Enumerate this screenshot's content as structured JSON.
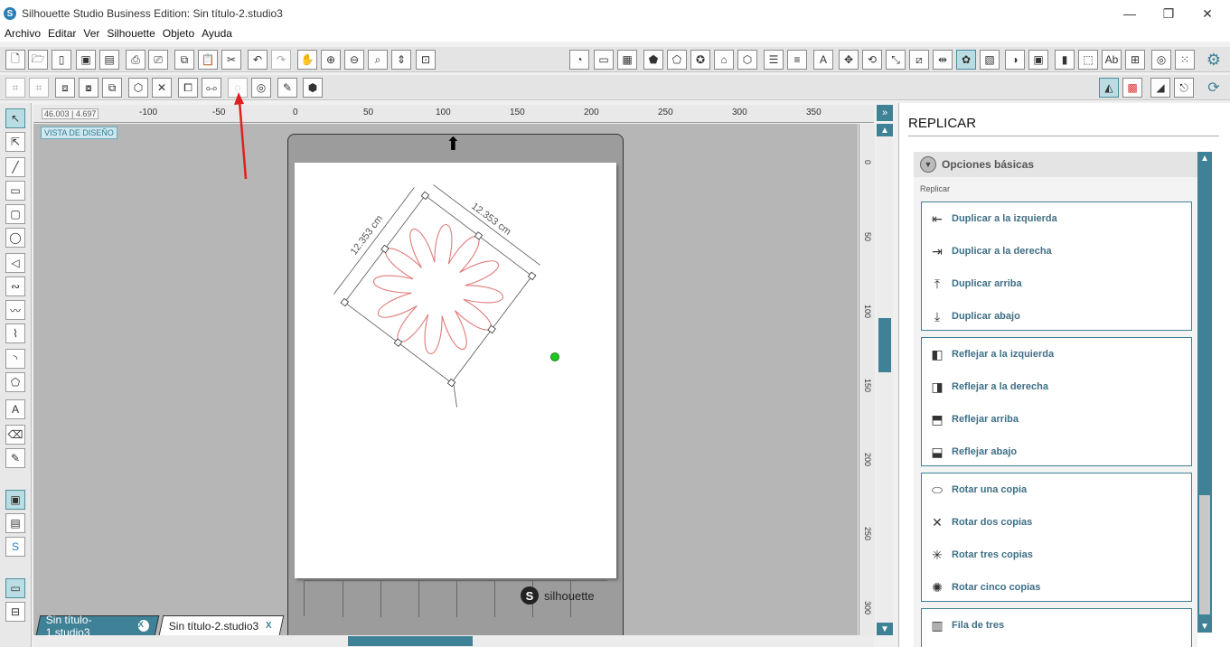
{
  "window": {
    "title": "Silhouette Studio Business Edition: Sin título-2.studio3",
    "minimize": "—",
    "restore": "❐",
    "close": "✕"
  },
  "menu": [
    "Archivo",
    "Editar",
    "Ver",
    "Silhouette",
    "Objeto",
    "Ayuda"
  ],
  "canvas": {
    "coords_x": "46.003",
    "coords_y": "4.697",
    "design_view_label": "VISTA DE DISEÑO",
    "dimension_top": "12.353 cm",
    "dimension_left": "12.353 cm",
    "mat_brand": "silhouette",
    "mat_logo_letter": "S",
    "ruler_h_labels": [
      "-100",
      "-50",
      "0",
      "50",
      "100",
      "150",
      "200",
      "250",
      "300",
      "350"
    ],
    "ruler_v_labels": [
      "0",
      "50",
      "100",
      "150",
      "200",
      "250",
      "300"
    ]
  },
  "tabs": [
    {
      "label": "Sin título-1.studio3",
      "close": "X",
      "active": false
    },
    {
      "label": "Sin título-2.studio3",
      "close": "X",
      "active": true
    }
  ],
  "panel": {
    "title": "REPLICAR",
    "section_label": "Opciones básicas",
    "subsection_label": "Replicar",
    "groups": [
      [
        {
          "label": "Duplicar a la izquierda",
          "icon": "duplicate-left-icon",
          "glyph": "⇤"
        },
        {
          "label": "Duplicar a la derecha",
          "icon": "duplicate-right-icon",
          "glyph": "⇥"
        },
        {
          "label": "Duplicar arriba",
          "icon": "duplicate-up-icon",
          "glyph": "⤒"
        },
        {
          "label": "Duplicar abajo",
          "icon": "duplicate-down-icon",
          "glyph": "⤓"
        }
      ],
      [
        {
          "label": "Reflejar a la izquierda",
          "icon": "mirror-left-icon",
          "glyph": "◧"
        },
        {
          "label": "Reflejar a la derecha",
          "icon": "mirror-right-icon",
          "glyph": "◨"
        },
        {
          "label": "Reflejar arriba",
          "icon": "mirror-up-icon",
          "glyph": "⬒"
        },
        {
          "label": "Reflejar abajo",
          "icon": "mirror-down-icon",
          "glyph": "⬓"
        }
      ],
      [
        {
          "label": "Rotar una copia",
          "icon": "rotate-one-copy-icon",
          "glyph": "⬭"
        },
        {
          "label": "Rotar dos copias",
          "icon": "rotate-two-copies-icon",
          "glyph": "✕"
        },
        {
          "label": "Rotar tres copias",
          "icon": "rotate-three-copies-icon",
          "glyph": "✳"
        },
        {
          "label": "Rotar cinco copias",
          "icon": "rotate-five-copies-icon",
          "glyph": "✺"
        }
      ],
      [
        {
          "label": "Fila de tres",
          "icon": "row-of-three-icon",
          "glyph": "▥"
        }
      ]
    ]
  },
  "colors": {
    "accent": "#3f8196",
    "shape_stroke": "#e07b7b",
    "rotate_handle": "#1ec81e",
    "annotation_arrow": "#e02020"
  }
}
